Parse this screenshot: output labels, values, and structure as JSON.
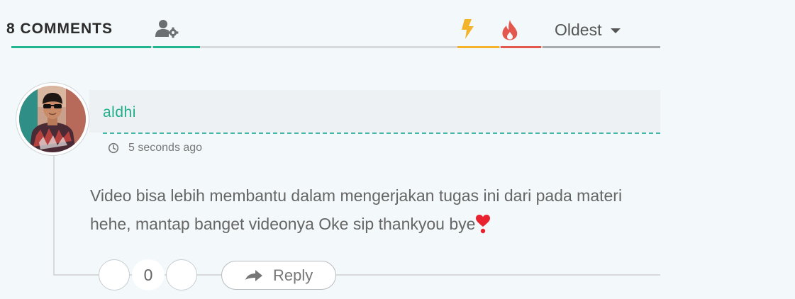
{
  "header": {
    "comment_count_label": "8 COMMENTS",
    "user_settings_icon": "user-settings-icon",
    "newest_icon": "bolt-icon",
    "popular_icon": "fire-icon",
    "sort_label": "Oldest",
    "colors": {
      "accent": "#1fb58f",
      "bolt": "#f3b32a",
      "fire": "#e4574d"
    }
  },
  "comment": {
    "author": "aldhi",
    "timestamp": "5 seconds ago",
    "text": "Video bisa lebih membantu dalam mengerjakan tugas ini dari pada materi hehe, mantap banget videonya Oke sip thankyou bye",
    "emoji_icon": "heart-exclamation-icon",
    "vote_count": "0",
    "reply_label": "Reply",
    "author_color": "#1fae8c"
  }
}
